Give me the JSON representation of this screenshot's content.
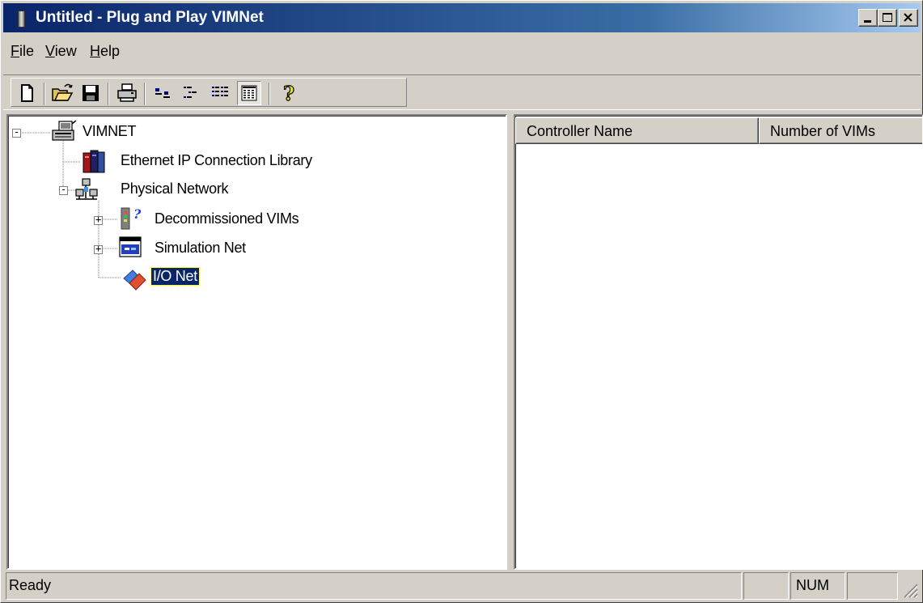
{
  "window": {
    "title": "Untitled - Plug and Play VIMNet",
    "controls": {
      "minimize": "minimize",
      "maximize": "maximize",
      "close": "close"
    }
  },
  "menu": {
    "file": "File",
    "view": "View",
    "help": "Help"
  },
  "toolbar": {
    "buttons": [
      {
        "name": "new-icon"
      },
      {
        "name": "open-icon"
      },
      {
        "name": "save-icon"
      },
      {
        "name": "print-icon"
      },
      {
        "name": "large-icons-icon"
      },
      {
        "name": "small-icons-icon"
      },
      {
        "name": "list-view-icon"
      },
      {
        "name": "details-view-icon",
        "pressed": true
      },
      {
        "name": "help-icon"
      }
    ]
  },
  "tree": {
    "root": {
      "label": "VIMNET",
      "expanded": true,
      "icon": "network-computer-icon"
    },
    "children": [
      {
        "label": "Ethernet IP Connection Library",
        "icon": "library-books-icon"
      },
      {
        "label": "Physical Network",
        "expanded": true,
        "icon": "physical-network-icon",
        "children": [
          {
            "label": "Decommissioned VIMs",
            "expanded": false,
            "icon": "decommissioned-vim-icon"
          },
          {
            "label": "Simulation Net",
            "expanded": false,
            "icon": "simulation-net-icon"
          },
          {
            "label": "I/O Net",
            "selected": true,
            "icon": "io-net-icon"
          }
        ]
      }
    ]
  },
  "list": {
    "columns": [
      "Controller Name",
      "Number of VIMs"
    ],
    "rows": []
  },
  "status": {
    "text": "Ready",
    "panel1": "",
    "num": "NUM",
    "panel3": ""
  },
  "colors": {
    "title_start": "#0a246a",
    "title_end": "#a6caf0",
    "face": "#d4d0c8",
    "selection": "#0a246a"
  }
}
